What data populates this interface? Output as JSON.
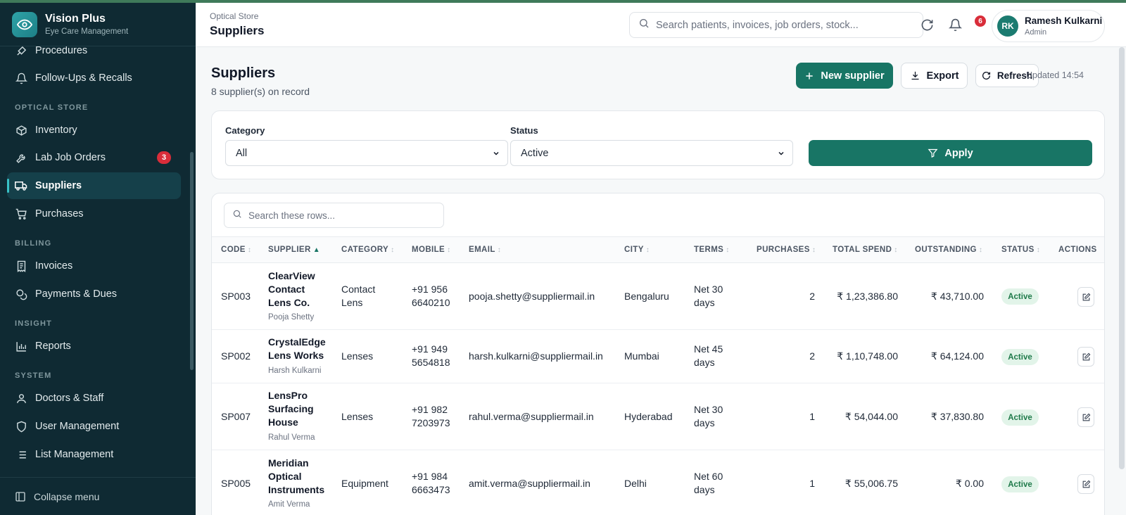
{
  "brand": {
    "name": "Vision Plus",
    "subtitle": "Eye Care Management"
  },
  "sidebar": {
    "items": [
      {
        "label": "Procedures",
        "icon": "procedures-icon"
      },
      {
        "label": "Follow-Ups & Recalls",
        "icon": "bell-icon"
      },
      {
        "label": "Inventory",
        "icon": "box-icon"
      },
      {
        "label": "Lab Job Orders",
        "icon": "tool-icon",
        "badge": "3"
      },
      {
        "label": "Suppliers",
        "icon": "truck-icon",
        "active": true
      },
      {
        "label": "Purchases",
        "icon": "cart-icon"
      },
      {
        "label": "Invoices",
        "icon": "receipt-icon"
      },
      {
        "label": "Payments & Dues",
        "icon": "coins-icon"
      },
      {
        "label": "Reports",
        "icon": "bar-chart-icon"
      },
      {
        "label": "Doctors & Staff",
        "icon": "user-icon"
      },
      {
        "label": "User Management",
        "icon": "shield-icon"
      },
      {
        "label": "List Management",
        "icon": "list-icon"
      }
    ],
    "sections": [
      "OPTICAL STORE",
      "BILLING",
      "INSIGHT",
      "SYSTEM"
    ],
    "collapse_label": "Collapse menu"
  },
  "header": {
    "breadcrumb": "Optical Store",
    "title": "Suppliers",
    "search_placeholder": "Search patients, invoices, job orders, stock...",
    "notification_count": "6",
    "user": {
      "initials": "RK",
      "name": "Ramesh Kulkarni",
      "role": "Admin"
    }
  },
  "page": {
    "title": "Suppliers",
    "subtitle": "8 supplier(s) on record",
    "new_button": "New supplier",
    "export_button": "Export",
    "refresh_button": "Refresh",
    "updated": "Updated 14:54"
  },
  "filters": {
    "category_label": "Category",
    "category_value": "All",
    "status_label": "Status",
    "status_value": "Active",
    "apply_label": "Apply"
  },
  "table": {
    "search_placeholder": "Search these rows...",
    "columns": [
      "CODE",
      "SUPPLIER",
      "CATEGORY",
      "MOBILE",
      "EMAIL",
      "CITY",
      "TERMS",
      "PURCHASES",
      "TOTAL SPEND",
      "OUTSTANDING",
      "STATUS",
      "ACTIONS"
    ],
    "rows": [
      {
        "code": "SP003",
        "name_lines": [
          "ClearView",
          "Contact",
          "Lens Co."
        ],
        "contact": "Pooja Shetty",
        "category_lines": [
          "Contact",
          "Lens"
        ],
        "mobile_lines": [
          "+91 956",
          "6640210"
        ],
        "email": "pooja.shetty@suppliermail.in",
        "city": "Bengaluru",
        "terms_lines": [
          "Net 30",
          "days"
        ],
        "purchases": "2",
        "total": "₹ 1,23,386.80",
        "outstanding": "₹ 43,710.00",
        "status": "Active"
      },
      {
        "code": "SP002",
        "name_lines": [
          "CrystalEdge",
          "Lens Works"
        ],
        "contact": "Harsh Kulkarni",
        "category_lines": [
          "Lenses"
        ],
        "mobile_lines": [
          "+91 949",
          "5654818"
        ],
        "email": "harsh.kulkarni@suppliermail.in",
        "city": "Mumbai",
        "terms_lines": [
          "Net 45",
          "days"
        ],
        "purchases": "2",
        "total": "₹ 1,10,748.00",
        "outstanding": "₹ 64,124.00",
        "status": "Active"
      },
      {
        "code": "SP007",
        "name_lines": [
          "LensPro",
          "Surfacing",
          "House"
        ],
        "contact": "Rahul Verma",
        "category_lines": [
          "Lenses"
        ],
        "mobile_lines": [
          "+91 982",
          "7203973"
        ],
        "email": "rahul.verma@suppliermail.in",
        "city": "Hyderabad",
        "terms_lines": [
          "Net 30",
          "days"
        ],
        "purchases": "1",
        "total": "₹ 54,044.00",
        "outstanding": "₹ 37,830.80",
        "status": "Active"
      },
      {
        "code": "SP005",
        "name_lines": [
          "Meridian",
          "Optical",
          "Instruments"
        ],
        "contact": "Amit Verma",
        "category_lines": [
          "Equipment"
        ],
        "mobile_lines": [
          "+91 984",
          "6663473"
        ],
        "email": "amit.verma@suppliermail.in",
        "city": "Delhi",
        "terms_lines": [
          "Net 60",
          "days"
        ],
        "purchases": "1",
        "total": "₹ 55,006.75",
        "outstanding": "₹ 0.00",
        "status": "Active"
      }
    ]
  },
  "colors": {
    "sidebar_bg": "#0f2a33",
    "accent": "#187565",
    "badge_red": "#d92d3a",
    "status_bg": "#e2f4e9"
  }
}
